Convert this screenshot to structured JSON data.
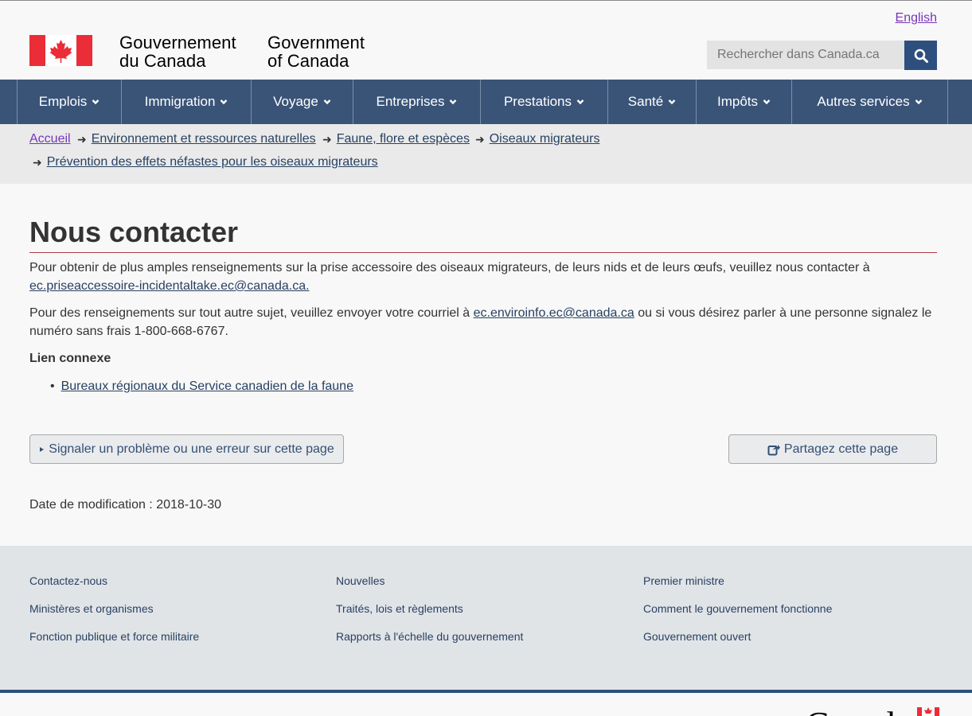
{
  "header": {
    "lang_link": "English",
    "wordmark_fr_line1": "Gouvernement",
    "wordmark_fr_line2": "du Canada",
    "wordmark_en_line1": "Government",
    "wordmark_en_line2": "of Canada",
    "search_placeholder": "Rechercher dans Canada.ca"
  },
  "nav": {
    "items": [
      {
        "label": "Emplois"
      },
      {
        "label": "Immigration"
      },
      {
        "label": "Voyage"
      },
      {
        "label": "Entreprises"
      },
      {
        "label": "Prestations"
      },
      {
        "label": "Santé"
      },
      {
        "label": "Impôts"
      },
      {
        "label": "Autres services"
      }
    ]
  },
  "breadcrumb": {
    "items": [
      {
        "label": "Accueil"
      },
      {
        "label": "Environnement et ressources naturelles"
      },
      {
        "label": "Faune, flore et espèces"
      },
      {
        "label": "Oiseaux migrateurs"
      },
      {
        "label": "Prévention des effets néfastes pour les oiseaux migrateurs"
      }
    ]
  },
  "main": {
    "title": "Nous contacter",
    "para1_text": "Pour obtenir de plus amples renseignements sur la prise accessoire des oiseaux migrateurs, de leurs nids et de leurs œufs, veuillez nous contacter à",
    "para1_email": "ec.priseaccessoire-incidentaltake.ec@canada.ca.",
    "para2_before": "Pour des renseignements sur tout autre sujet, veuillez envoyer votre courriel à ",
    "para2_email": "ec.enviroinfo.ec@canada.ca",
    "para2_after": " ou si vous désirez parler à une personne signalez le numéro sans frais 1-800-668-6767.",
    "related_heading": "Lien connexe",
    "related_links": [
      {
        "label": "Bureaux régionaux du Service canadien de la faune"
      }
    ],
    "report_button": "Signaler un problème ou une erreur sur cette page",
    "share_button": "Partagez cette page",
    "date_modified": "Date de modification : 2018-10-30"
  },
  "footer": {
    "col1": [
      {
        "label": "Contactez-nous"
      },
      {
        "label": "Ministères et organismes"
      },
      {
        "label": "Fonction publique et force militaire"
      }
    ],
    "col2": [
      {
        "label": "Nouvelles"
      },
      {
        "label": "Traités, lois et règlements"
      },
      {
        "label": "Rapports à l'échelle du gouvernement"
      }
    ],
    "col3": [
      {
        "label": "Premier ministre"
      },
      {
        "label": "Comment le gouvernement fonctionne"
      },
      {
        "label": "Gouvernement ouvert"
      }
    ],
    "canada_wordmark": "Canada"
  },
  "colors": {
    "nav_bg": "#3a5478",
    "flag_red": "#eb2d37",
    "accent_rule": "#af3c43",
    "link": "#284162",
    "visited": "#7834bc"
  },
  "icons": {
    "search": "search-icon",
    "caret": "chevron-down-icon",
    "share": "share-icon",
    "report": "triangle-right-icon",
    "flag": "canada-flag-icon"
  }
}
